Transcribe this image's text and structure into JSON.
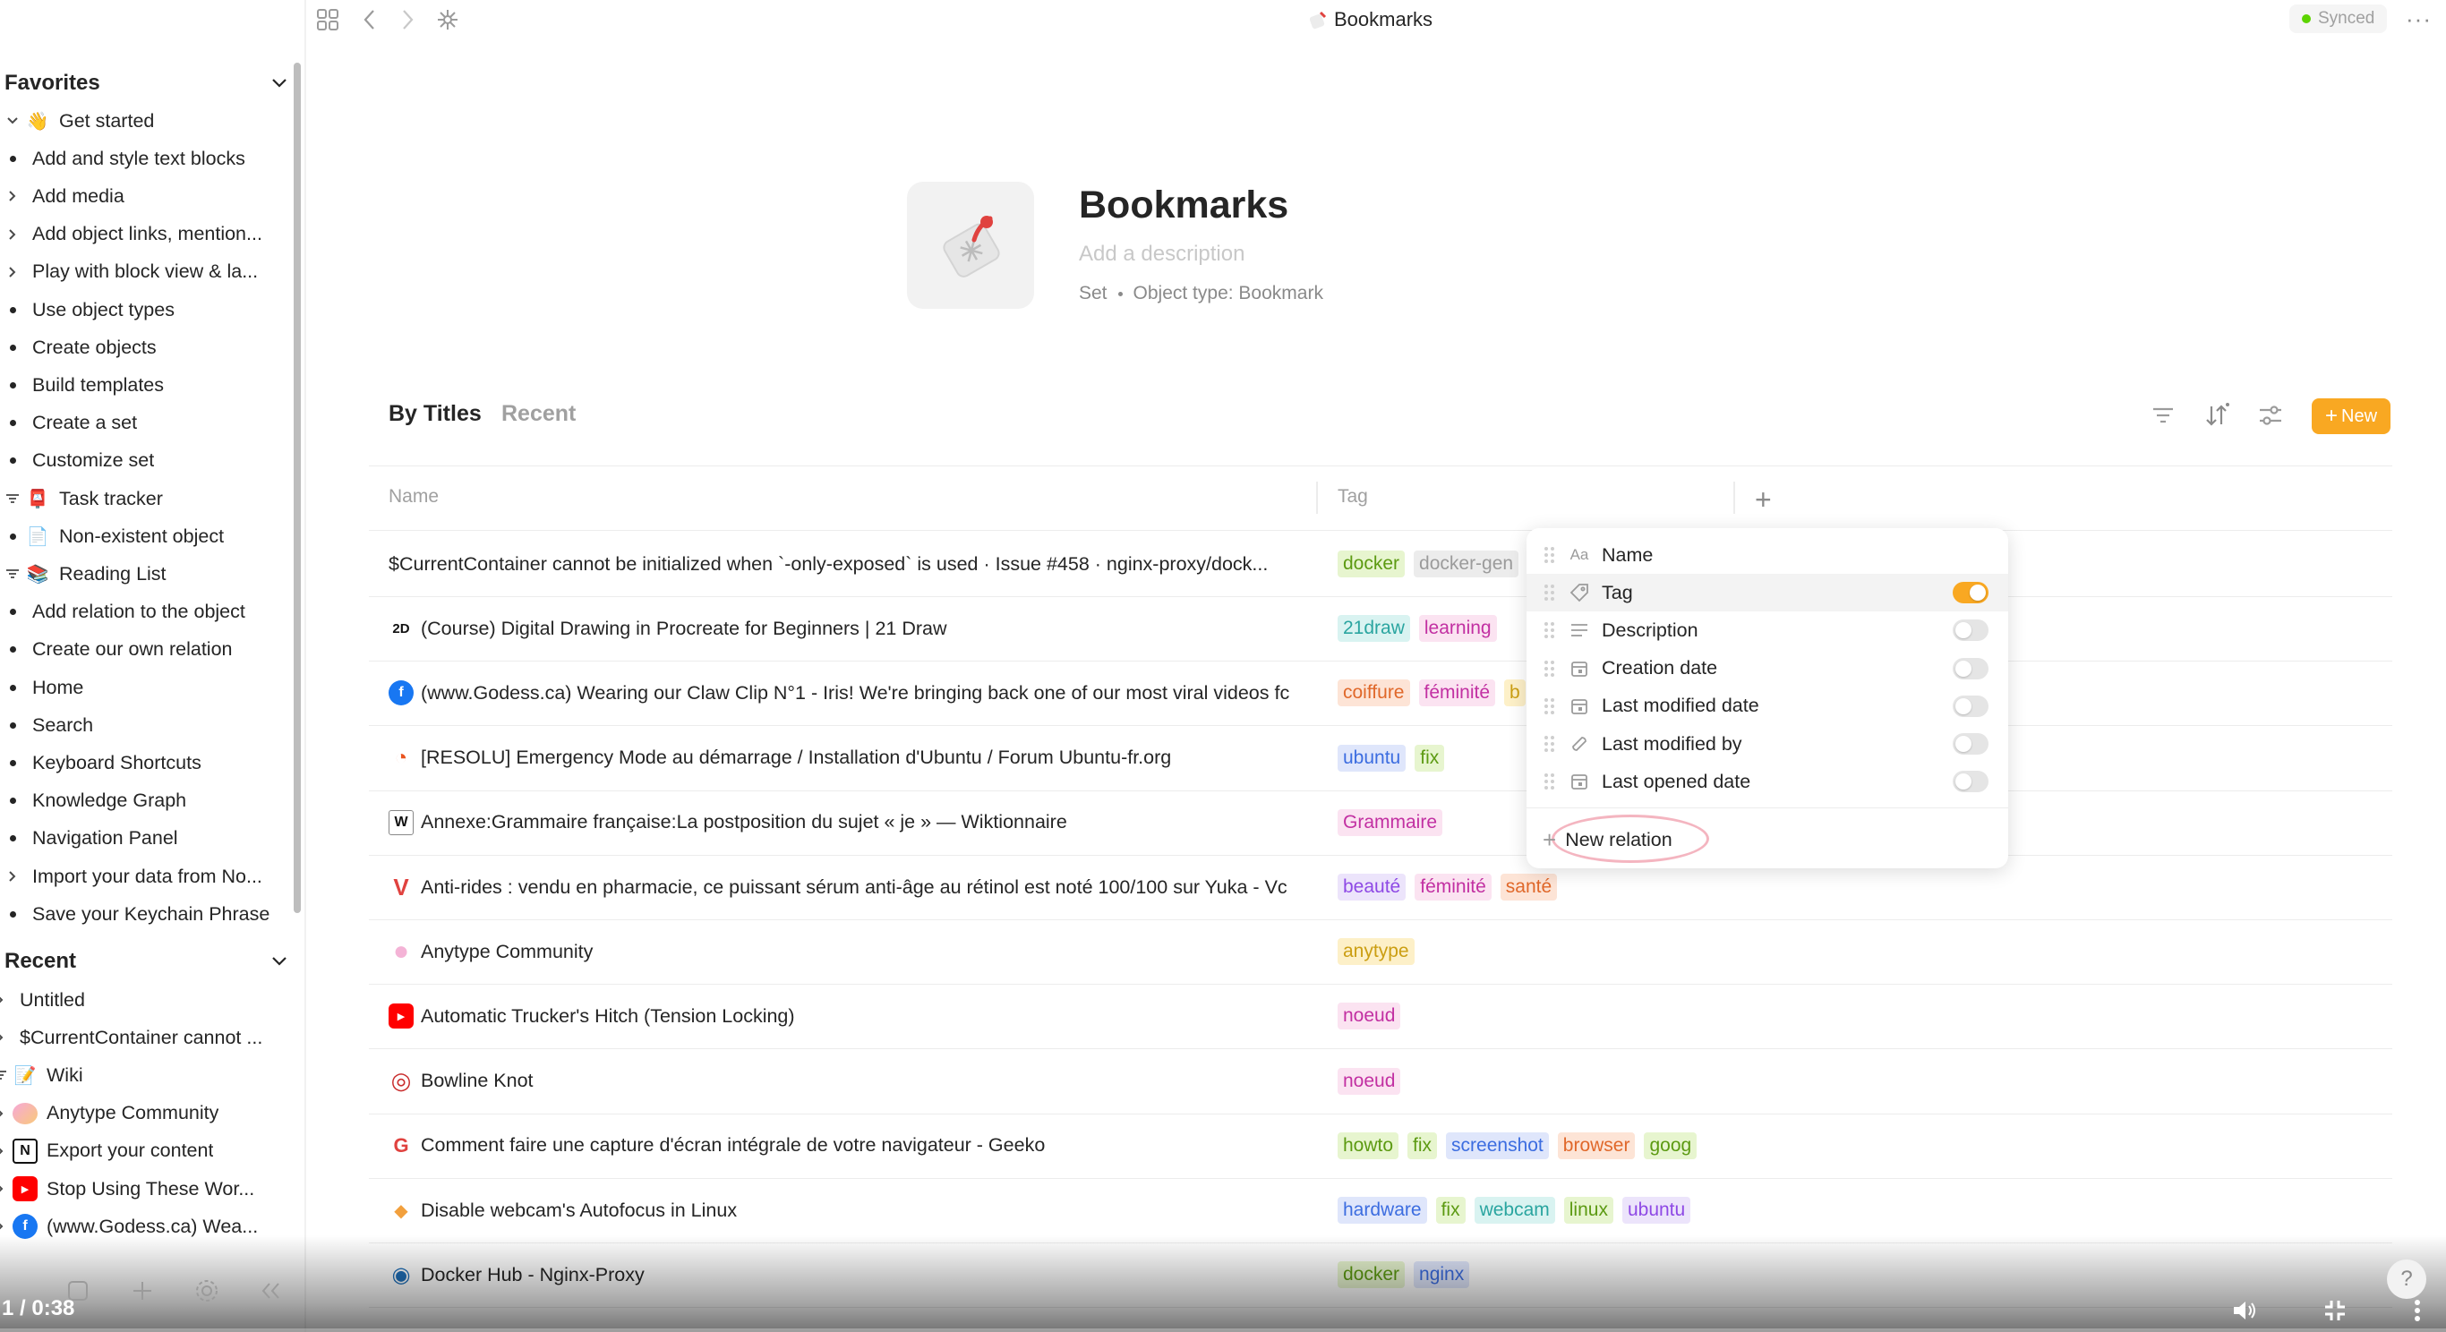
{
  "topbar": {
    "title": "Bookmarks",
    "title_icon": "bookmark-tag-icon",
    "synced_label": "Synced",
    "more_glyph": "···"
  },
  "sidebar": {
    "favorites_label": "Favorites",
    "recent_label": "Recent",
    "favorites": [
      {
        "label": "Get started",
        "lead": "chevron-down",
        "icon": "👋"
      },
      {
        "label": "Add and style text blocks",
        "lead": "dot"
      },
      {
        "label": "Add media",
        "lead": "chevron-right"
      },
      {
        "label": "Add object links, mention...",
        "lead": "chevron-right"
      },
      {
        "label": "Play with block view & la...",
        "lead": "chevron-right"
      },
      {
        "label": "Use object types",
        "lead": "dot"
      },
      {
        "label": "Create objects",
        "lead": "dot"
      },
      {
        "label": "Build templates",
        "lead": "dot"
      },
      {
        "label": "Create a set",
        "lead": "dot"
      },
      {
        "label": "Customize set",
        "lead": "dot"
      },
      {
        "label": "Task tracker",
        "lead": "filter",
        "icon": "📮"
      },
      {
        "label": "Non-existent object",
        "lead": "dot",
        "icon": "📄"
      },
      {
        "label": "Reading List",
        "lead": "filter",
        "icon": "📚"
      },
      {
        "label": "Add relation to the object",
        "lead": "dot"
      },
      {
        "label": "Create our own relation",
        "lead": "dot"
      },
      {
        "label": "Home",
        "lead": "dot"
      },
      {
        "label": "Search",
        "lead": "dot"
      },
      {
        "label": "Keyboard Shortcuts",
        "lead": "dot"
      },
      {
        "label": "Knowledge Graph",
        "lead": "dot"
      },
      {
        "label": "Navigation Panel",
        "lead": "dot"
      },
      {
        "label": "Import your data from No...",
        "lead": "chevron-right"
      },
      {
        "label": "Save your Keychain Phrase",
        "lead": "dot"
      }
    ],
    "recent": [
      {
        "label": "Untitled",
        "lead": "chevron-right"
      },
      {
        "label": "$CurrentContainer cannot ...",
        "lead": "chevron-right"
      },
      {
        "label": "Wiki",
        "lead": "filter",
        "icon": "📝"
      },
      {
        "label": "Anytype Community",
        "lead": "chevron-right",
        "icon": "🟣"
      },
      {
        "label": "Export your content",
        "lead": "chevron-right",
        "icon": "N"
      },
      {
        "label": "Stop Using These Wor...",
        "lead": "chevron-right",
        "icon": "▶"
      },
      {
        "label": "(www.Godess.ca) Wea...",
        "lead": "chevron-right",
        "icon": "f"
      }
    ]
  },
  "header": {
    "title": "Bookmarks",
    "description_placeholder": "Add a description",
    "meta_set": "Set",
    "meta_type": "Object type: Bookmark"
  },
  "views": {
    "tabs": [
      "By Titles",
      "Recent"
    ],
    "new_button": "New"
  },
  "table": {
    "columns": [
      "Name",
      "Tag"
    ],
    "rows": [
      {
        "name": "$CurrentContainer cannot be initialized when `-only-exposed` is used · Issue #458 · nginx-proxy/dock...",
        "icon": "",
        "tags": [
          {
            "t": "docker",
            "c": "lime"
          },
          {
            "t": "docker-gen",
            "c": "grey"
          }
        ]
      },
      {
        "name": "(Course) Digital Drawing in Procreate for Beginners | 21 Draw",
        "icon": "2D",
        "tags": [
          {
            "t": "21draw",
            "c": "teal"
          },
          {
            "t": "learning",
            "c": "pink"
          }
        ]
      },
      {
        "name": "(www.Godess.ca) Wearing our Claw Clip N°1 - Iris! We're bringing back one of our most viral videos fc",
        "icon": "f",
        "tags": [
          {
            "t": "coiffure",
            "c": "orange"
          },
          {
            "t": "féminité",
            "c": "pink"
          },
          {
            "t": "b",
            "c": "yellow"
          }
        ]
      },
      {
        "name": "[RESOLU] Emergency Mode au démarrage / Installation d'Ubuntu / Forum Ubuntu-fr.org",
        "icon": "◔",
        "tags": [
          {
            "t": "ubuntu",
            "c": "blue"
          },
          {
            "t": "fix",
            "c": "lime"
          }
        ]
      },
      {
        "name": "Annexe:Grammaire française:La postposition du sujet « je » — Wiktionnaire",
        "icon": "W",
        "tags": [
          {
            "t": "Grammaire",
            "c": "pink"
          }
        ]
      },
      {
        "name": "Anti-rides : vendu en pharmacie, ce puissant sérum anti-âge au rétinol est noté 100/100 sur Yuka - Vc",
        "icon": "V",
        "tags": [
          {
            "t": "beauté",
            "c": "purple"
          },
          {
            "t": "féminité",
            "c": "pink"
          },
          {
            "t": "santé",
            "c": "orange"
          }
        ]
      },
      {
        "name": "Anytype Community",
        "icon": "●",
        "tags": [
          {
            "t": "anytype",
            "c": "yellow"
          }
        ]
      },
      {
        "name": "Automatic Trucker's Hitch (Tension Locking)",
        "icon": "▶",
        "tags": [
          {
            "t": "noeud",
            "c": "pink"
          }
        ]
      },
      {
        "name": "Bowline Knot",
        "icon": "◎",
        "tags": [
          {
            "t": "noeud",
            "c": "pink"
          }
        ]
      },
      {
        "name": "Comment faire une capture d'écran intégrale de votre navigateur - Geeko",
        "icon": "G",
        "tags": [
          {
            "t": "howto",
            "c": "lime"
          },
          {
            "t": "fix",
            "c": "lime"
          },
          {
            "t": "screenshot",
            "c": "blue"
          },
          {
            "t": "browser",
            "c": "orange"
          },
          {
            "t": "goog",
            "c": "lime"
          }
        ]
      },
      {
        "name": "Disable webcam's Autofocus in Linux",
        "icon": "◆",
        "tags": [
          {
            "t": "hardware",
            "c": "blue"
          },
          {
            "t": "fix",
            "c": "lime"
          },
          {
            "t": "webcam",
            "c": "teal"
          },
          {
            "t": "linux",
            "c": "lime"
          },
          {
            "t": "ubuntu",
            "c": "purple"
          }
        ]
      },
      {
        "name": "Docker Hub - Nginx-Proxy",
        "icon": "◉",
        "tags": [
          {
            "t": "docker",
            "c": "lime"
          },
          {
            "t": "nginx",
            "c": "blue"
          }
        ]
      }
    ]
  },
  "relation_popup": {
    "items": [
      {
        "label": "Name",
        "icon": "Aa",
        "toggle": null
      },
      {
        "label": "Tag",
        "icon": "tag-icon",
        "toggle": true
      },
      {
        "label": "Description",
        "icon": "lines-icon",
        "toggle": false
      },
      {
        "label": "Creation date",
        "icon": "calendar-icon",
        "toggle": false
      },
      {
        "label": "Last modified date",
        "icon": "calendar-icon",
        "toggle": false
      },
      {
        "label": "Last modified by",
        "icon": "object-icon",
        "toggle": false
      },
      {
        "label": "Last opened date",
        "icon": "calendar-icon",
        "toggle": false
      }
    ],
    "new_relation_label": "New relation"
  },
  "video": {
    "time": "1 / 0:38"
  },
  "help_glyph": "?",
  "colors": {
    "accent": "#f9a822",
    "synced_dot": "#5dd400",
    "text": "#252525",
    "muted": "#a0a0a0"
  }
}
